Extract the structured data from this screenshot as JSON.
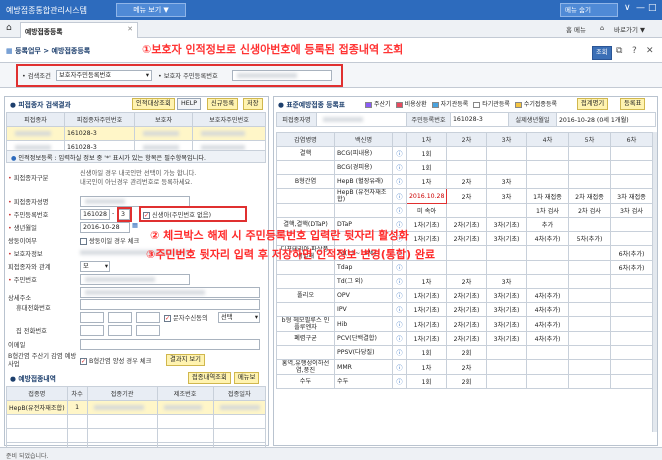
{
  "app": {
    "title": "예방접종통합관리시스템",
    "menu_btn": "메뉴 보기 ▼",
    "right_menu": "메뉴 숨기",
    "window_controls": [
      "∨",
      "—",
      "□"
    ]
  },
  "tabs": {
    "home_icon": "home-icon",
    "active": "예방접종등록",
    "tools": [
      "홈 메뉴",
      "⌂",
      "바로가기 ▼"
    ]
  },
  "breadcrumb": "등록업무 > 예방접종등록",
  "annotations": {
    "a1": "①보호자 인적정보로 신생아번호에 등록된 접종내역 조회",
    "a2": "② 체크박스 해제 시 주민등록번호 입력란 뒷자리 활성화",
    "a3": "③주민번호 뒷자리 입력 후 저장하면 인적정보 변경(통합) 완료"
  },
  "search": {
    "cond_label": "• 검색조건",
    "cond_value": "보호자주민등록번호",
    "field_label": "• 보호자 주민등록번호",
    "query_btn": "조회"
  },
  "left": {
    "title": "피접종자 검색결과",
    "buttons": [
      "인적대상조회",
      "HELP",
      "신규등록",
      "저장"
    ],
    "columns": [
      "피접종자",
      "피접종자주민번호",
      "보호자",
      "보호자주민번호"
    ],
    "rows": [
      [
        "",
        "161028-3",
        "",
        ""
      ],
      [
        "",
        "161028-3",
        "",
        ""
      ]
    ],
    "info_note": "인적정보등록 : 입력하실 정보 중 '*' 표시가 있는 항목은 필수항목입니다.",
    "form": {
      "type_label": "피접종자구분",
      "type_text1": "신생아일 경우 내국인만 선택이 가능 합니다.",
      "type_text2": "내국인이 아닌경우 관리번호로 등록하세요.",
      "name_label": "피접종자성명",
      "rrn_label": "주민등록번호",
      "rrn_front": "161028",
      "rrn_back": "3",
      "newborn_label": "신생아(주민번호 없음)",
      "birth_label": "생년월일",
      "birth_value": "2016-10-28",
      "twin_label": "쌍둥이여부",
      "twin_text": "쌍둥이일 경우 체크",
      "guardian_label": "보호자정보",
      "relation_label": "피접종자와 관계",
      "relation_value": "모",
      "rrn2_label": "주민번호",
      "address_label": "상세주소",
      "phone_label": "휴대전화번호",
      "sms_label": "문자수신동의",
      "sms_value": "선택",
      "tel_label": "집 전화번호",
      "email_label": "이메일",
      "project_label": "B형간염 주산기 감염 예방사업",
      "project_check": "B형간염 양성 경우 체크",
      "result_btn": "결과지 보기"
    },
    "history": {
      "title": "예방접종내역",
      "buttons": [
        "접종내역조회",
        "메뉴보"
      ],
      "columns": [
        "접종명",
        "차수",
        "접종기관",
        "제조번호",
        "접종일자"
      ],
      "rows": [
        [
          "HepB(유전자재조합)",
          "1",
          "",
          "",
          ""
        ]
      ]
    }
  },
  "right": {
    "title": "표준예방접종 등록표",
    "legend": [
      {
        "label": "주산기",
        "color": "#8b5cf6"
      },
      {
        "label": "비용상환",
        "color": "#e84a5f"
      },
      {
        "label": "자기관등록",
        "color": "#4aa3df"
      },
      {
        "label": "타기관등록",
        "color": "#ffffff"
      },
      {
        "label": "수기접종등록",
        "color": "#f5c542"
      }
    ],
    "buttons": [
      "접계명기",
      "등록표"
    ],
    "info": {
      "name_label": "피접종자명",
      "rrn_label": "주민등록번호",
      "rrn_value": "161028-3",
      "birth_label": "실제생년월일",
      "birth_value": "2016-10-28 (0세 1개월)"
    },
    "columns": [
      "감염병명",
      "백신명",
      "",
      "1차",
      "2차",
      "3차",
      "4차",
      "5차",
      "6차"
    ],
    "rows": [
      [
        "결핵",
        "BCG(피내용)",
        "1회",
        "",
        "",
        "",
        "",
        ""
      ],
      [
        "",
        "BCG(경피용)",
        "1회",
        "",
        "",
        "",
        "",
        ""
      ],
      [
        "B형간염",
        "HepB (혈장유래)",
        "1차",
        "2차",
        "3차",
        "",
        "",
        ""
      ],
      [
        "",
        "HepB (유전자재조합)",
        "2016.10.28",
        "2차",
        "3차",
        "1차 재접종",
        "2차 재접종",
        "3차 재접종"
      ],
      [
        "",
        "",
        "미 속아",
        "",
        "",
        "1차 검사",
        "2차 검사",
        "3차 검사"
      ],
      [
        "결핵,결핵(DTaP)",
        "DTaP",
        "1차(기초)",
        "2차(기초)",
        "3차(기초)",
        "추가",
        "",
        ""
      ],
      [
        "",
        "",
        "1차(기초)",
        "2차(기초)",
        "3차(기초)",
        "4차(추가)",
        "5차(추가)",
        ""
      ],
      [
        "디프테리아,파상풍,백일해",
        "Td(11~12세)",
        "",
        "",
        "",
        "",
        "",
        "6차(추가)"
      ],
      [
        "",
        "Tdap",
        "",
        "",
        "",
        "",
        "",
        "6차(추가)"
      ],
      [
        "",
        "Td(그 외)",
        "1차",
        "2차",
        "3차",
        "",
        "",
        ""
      ],
      [
        "폴리오",
        "OPV",
        "1차(기초)",
        "2차(기초)",
        "3차(기초)",
        "4차(추가)",
        "",
        ""
      ],
      [
        "",
        "IPV",
        "1차(기초)",
        "2차(기초)",
        "3차(기초)",
        "4차(추가)",
        "",
        ""
      ],
      [
        "b형 헤모필루스 인플루엔자",
        "Hib",
        "1차(기초)",
        "2차(기초)",
        "3차(기초)",
        "4차(추가)",
        "",
        ""
      ],
      [
        "폐렴구균",
        "PCV(단백결합)",
        "1차(기초)",
        "2차(기초)",
        "3차(기초)",
        "4차(추가)",
        "",
        ""
      ],
      [
        "",
        "PPSV(다당질)",
        "1회",
        "2회",
        "",
        "",
        "",
        ""
      ],
      [
        "홍역,유행성이하선염,풍진",
        "MMR",
        "1차",
        "2차",
        "",
        "",
        "",
        ""
      ],
      [
        "수두",
        "수두",
        "1회",
        "2회",
        "",
        "",
        "",
        ""
      ]
    ]
  },
  "status": "준비 되었습니다."
}
